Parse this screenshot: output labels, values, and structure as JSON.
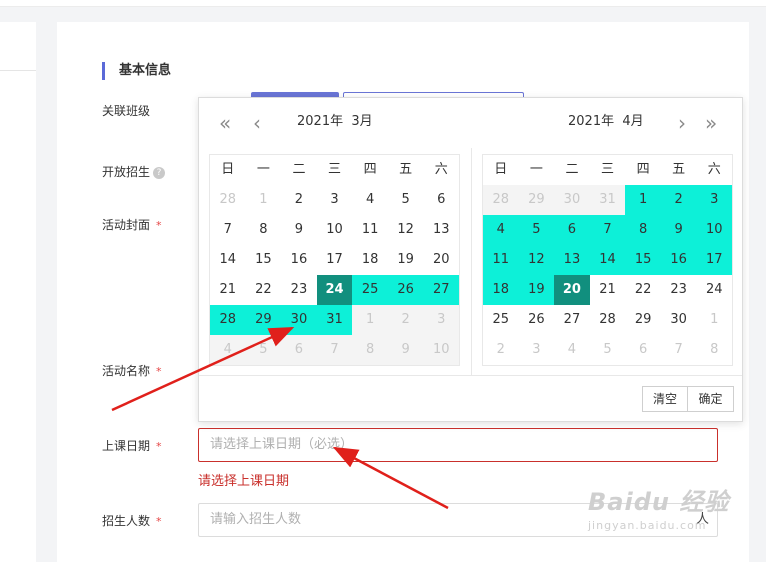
{
  "section": {
    "title": "基本信息"
  },
  "labels": {
    "class": "关联班级",
    "enroll": "开放招生",
    "cover": "活动封面",
    "name": "活动名称",
    "date": "上课日期",
    "count": "招生人数",
    "required_mark": "*",
    "help_glyph": "?"
  },
  "date_field": {
    "placeholder": "请选择上课日期（必选）",
    "error": "请选择上课日期"
  },
  "count_field": {
    "placeholder": "请输入招生人数",
    "icon": "人"
  },
  "datepicker": {
    "nav": {
      "prev_year": "«",
      "prev_month": "‹",
      "next_month": "›",
      "next_year": "»"
    },
    "weekdays": [
      "日",
      "一",
      "二",
      "三",
      "四",
      "五",
      "六"
    ],
    "left_title": "2021年  3月",
    "right_title": "2021年  4月",
    "left_days": [
      [
        {
          "d": "28",
          "s": "other"
        },
        {
          "d": "1",
          "s": "other"
        },
        {
          "d": "2",
          "s": ""
        },
        {
          "d": "3",
          "s": ""
        },
        {
          "d": "4",
          "s": ""
        },
        {
          "d": "5",
          "s": ""
        },
        {
          "d": "6",
          "s": ""
        }
      ],
      [
        {
          "d": "7",
          "s": ""
        },
        {
          "d": "8",
          "s": ""
        },
        {
          "d": "9",
          "s": ""
        },
        {
          "d": "10",
          "s": ""
        },
        {
          "d": "11",
          "s": ""
        },
        {
          "d": "12",
          "s": ""
        },
        {
          "d": "13",
          "s": ""
        }
      ],
      [
        {
          "d": "14",
          "s": ""
        },
        {
          "d": "15",
          "s": ""
        },
        {
          "d": "16",
          "s": ""
        },
        {
          "d": "17",
          "s": ""
        },
        {
          "d": "18",
          "s": ""
        },
        {
          "d": "19",
          "s": ""
        },
        {
          "d": "20",
          "s": ""
        }
      ],
      [
        {
          "d": "21",
          "s": ""
        },
        {
          "d": "22",
          "s": ""
        },
        {
          "d": "23",
          "s": ""
        },
        {
          "d": "24",
          "s": "endpoint"
        },
        {
          "d": "25",
          "s": "inrange"
        },
        {
          "d": "26",
          "s": "inrange"
        },
        {
          "d": "27",
          "s": "inrange"
        }
      ],
      [
        {
          "d": "28",
          "s": "inrange"
        },
        {
          "d": "29",
          "s": "inrange"
        },
        {
          "d": "30",
          "s": "inrange"
        },
        {
          "d": "31",
          "s": "inrange"
        },
        {
          "d": "1",
          "s": "disabled"
        },
        {
          "d": "2",
          "s": "disabled"
        },
        {
          "d": "3",
          "s": "disabled"
        }
      ],
      [
        {
          "d": "4",
          "s": "disabled"
        },
        {
          "d": "5",
          "s": "disabled"
        },
        {
          "d": "6",
          "s": "disabled"
        },
        {
          "d": "7",
          "s": "disabled"
        },
        {
          "d": "8",
          "s": "disabled"
        },
        {
          "d": "9",
          "s": "disabled"
        },
        {
          "d": "10",
          "s": "disabled"
        }
      ]
    ],
    "right_days": [
      [
        {
          "d": "28",
          "s": "disabled"
        },
        {
          "d": "29",
          "s": "disabled"
        },
        {
          "d": "30",
          "s": "disabled"
        },
        {
          "d": "31",
          "s": "disabled"
        },
        {
          "d": "1",
          "s": "inrange"
        },
        {
          "d": "2",
          "s": "inrange"
        },
        {
          "d": "3",
          "s": "inrange"
        }
      ],
      [
        {
          "d": "4",
          "s": "inrange"
        },
        {
          "d": "5",
          "s": "inrange"
        },
        {
          "d": "6",
          "s": "inrange"
        },
        {
          "d": "7",
          "s": "inrange"
        },
        {
          "d": "8",
          "s": "inrange"
        },
        {
          "d": "9",
          "s": "inrange"
        },
        {
          "d": "10",
          "s": "inrange"
        }
      ],
      [
        {
          "d": "11",
          "s": "inrange"
        },
        {
          "d": "12",
          "s": "inrange"
        },
        {
          "d": "13",
          "s": "inrange"
        },
        {
          "d": "14",
          "s": "inrange"
        },
        {
          "d": "15",
          "s": "inrange"
        },
        {
          "d": "16",
          "s": "inrange"
        },
        {
          "d": "17",
          "s": "inrange"
        }
      ],
      [
        {
          "d": "18",
          "s": "inrange"
        },
        {
          "d": "19",
          "s": "inrange"
        },
        {
          "d": "20",
          "s": "endpoint"
        },
        {
          "d": "21",
          "s": ""
        },
        {
          "d": "22",
          "s": ""
        },
        {
          "d": "23",
          "s": ""
        },
        {
          "d": "24",
          "s": ""
        }
      ],
      [
        {
          "d": "25",
          "s": ""
        },
        {
          "d": "26",
          "s": ""
        },
        {
          "d": "27",
          "s": ""
        },
        {
          "d": "28",
          "s": ""
        },
        {
          "d": "29",
          "s": ""
        },
        {
          "d": "30",
          "s": ""
        },
        {
          "d": "1",
          "s": "other"
        }
      ],
      [
        {
          "d": "2",
          "s": "other"
        },
        {
          "d": "3",
          "s": "other"
        },
        {
          "d": "4",
          "s": "other"
        },
        {
          "d": "5",
          "s": "other"
        },
        {
          "d": "6",
          "s": "other"
        },
        {
          "d": "7",
          "s": "other"
        },
        {
          "d": "8",
          "s": "other"
        }
      ]
    ],
    "footer": {
      "clear": "清空",
      "confirm": "确定"
    }
  },
  "watermark": {
    "main": "Baidu 经验",
    "sub": "jingyan.baidu.com"
  },
  "colors": {
    "accent": "#5b6ad8",
    "range": "#0df0d8",
    "endpoint": "#118f7e",
    "error": "#c9302c",
    "annotation_arrow": "#e0201b"
  }
}
